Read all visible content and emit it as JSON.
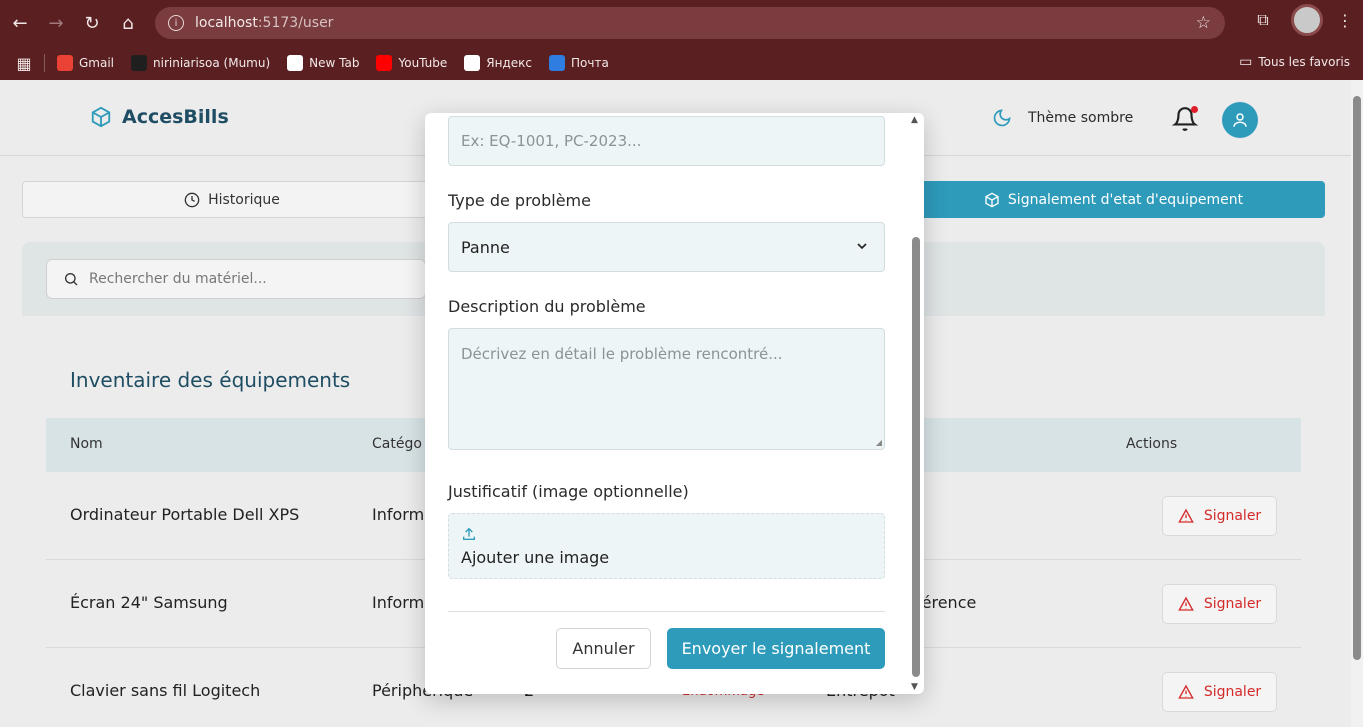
{
  "browser": {
    "url_host": "localhost",
    "url_path": ":5173/user",
    "bookmarks": [
      {
        "label": "Gmail",
        "icon": "gmail-icon",
        "color": "#ea4335"
      },
      {
        "label": "niriniarisoa (Mumu)",
        "icon": "github-icon",
        "color": "#1f1f1f"
      },
      {
        "label": "New Tab",
        "icon": "chrome-icon",
        "color": "#ffffff"
      },
      {
        "label": "YouTube",
        "icon": "youtube-icon",
        "color": "#ff0000"
      },
      {
        "label": "Яндекс",
        "icon": "yandex-icon",
        "color": "#ffffff"
      },
      {
        "label": "Почта",
        "icon": "mail-icon",
        "color": "#2f7de1"
      }
    ],
    "all_bookmarks": "Tous les favoris"
  },
  "app": {
    "brand": "AccesBills",
    "theme_label": "Thème sombre",
    "accent_color": "#2e9bbb",
    "tabs": {
      "history": "Historique",
      "report": "Signalement d'etat d'equipement"
    },
    "search_placeholder": "Rechercher du matériel...",
    "inventory": {
      "title": "Inventaire des équipements",
      "columns": {
        "name": "Nom",
        "category": "Catégo",
        "actions": "Actions"
      },
      "rows": [
        {
          "name": "Ordinateur Portable Dell XPS",
          "category": "Inform",
          "qty": "",
          "status": "",
          "location": "",
          "action": "Signaler"
        },
        {
          "name": "Écran 24\" Samsung",
          "category": "Inform",
          "qty": "",
          "status": "",
          "location": "férence",
          "action": "Signaler"
        },
        {
          "name": "Clavier sans fil Logitech",
          "category": "Périphérique",
          "qty": "2",
          "status": "Endommagé",
          "location": "Entrepôt",
          "action": "Signaler"
        }
      ]
    }
  },
  "modal": {
    "reference_placeholder": "Ex: EQ-1001, PC-2023...",
    "type_label": "Type de problème",
    "type_value": "Panne",
    "description_label": "Description du problème",
    "description_placeholder": "Décrivez en détail le problème rencontré...",
    "proof_label": "Justificatif (image optionnelle)",
    "upload_label": "Ajouter une image",
    "cancel_label": "Annuler",
    "submit_label": "Envoyer le signalement"
  }
}
